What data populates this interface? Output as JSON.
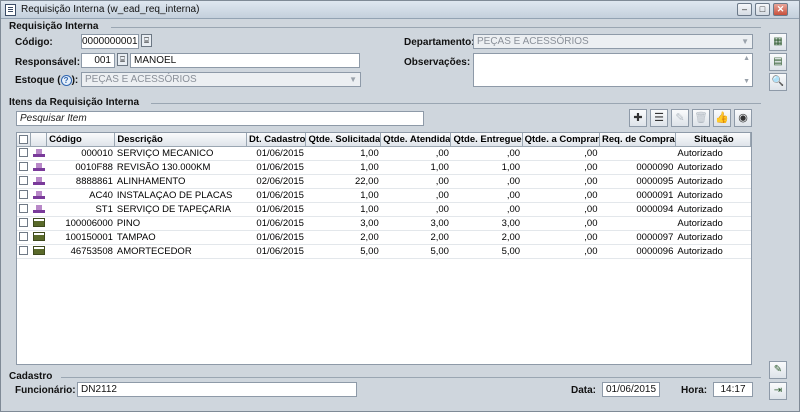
{
  "window": {
    "title": "Requisição Interna (w_ead_req_interna)"
  },
  "header_section": {
    "label": "Requisição Interna",
    "codigo_label": "Código:",
    "codigo_value": "0000000001",
    "responsavel_label": "Responsável:",
    "responsavel_code": "001",
    "responsavel_name": "MANOEL",
    "estoque_label": "Estoque (",
    "estoque_label_end": "):",
    "help_glyph": "?",
    "estoque_value": "PEÇAS E ACESSÓRIOS",
    "departamento_label": "Departamento:",
    "departamento_value": "PEÇAS E ACESSÓRIOS",
    "observacoes_label": "Observações:"
  },
  "items_section": {
    "label": "Itens da Requisição Interna",
    "search_placeholder": "Pesquisar Item",
    "columns": [
      "",
      "",
      "Código",
      "Descrição",
      "Dt. Cadastro",
      "Qtde. Solicitada",
      "Qtde. Atendida",
      "Qtde. Entregue",
      "Qtde. a Comprar",
      "Req. de Compra",
      "Situação"
    ],
    "rows": [
      {
        "type": "service",
        "codigo": "000010",
        "descricao": "SERVIÇO MECANICO",
        "dt": "01/06/2015",
        "solicitada": "1,00",
        "atendida": ",00",
        "entregue": ",00",
        "comprar": ",00",
        "req": "",
        "situacao": "Autorizado"
      },
      {
        "type": "service",
        "codigo": "0010F88",
        "descricao": "REVISÃO 130.000KM",
        "dt": "01/06/2015",
        "solicitada": "1,00",
        "atendida": "1,00",
        "entregue": "1,00",
        "comprar": ",00",
        "req": "0000090",
        "situacao": "Autorizado"
      },
      {
        "type": "service",
        "codigo": "8888861",
        "descricao": "ALINHAMENTO",
        "dt": "02/06/2015",
        "solicitada": "22,00",
        "atendida": ",00",
        "entregue": ",00",
        "comprar": ",00",
        "req": "0000095",
        "situacao": "Autorizado"
      },
      {
        "type": "service",
        "codigo": "AC40",
        "descricao": "INSTALAÇAO DE PLACAS",
        "dt": "01/06/2015",
        "solicitada": "1,00",
        "atendida": ",00",
        "entregue": ",00",
        "comprar": ",00",
        "req": "0000091",
        "situacao": "Autorizado"
      },
      {
        "type": "service",
        "codigo": "ST1",
        "descricao": "SERVIÇO DE TAPEÇARIA",
        "dt": "01/06/2015",
        "solicitada": "1,00",
        "atendida": ",00",
        "entregue": ",00",
        "comprar": ",00",
        "req": "0000094",
        "situacao": "Autorizado"
      },
      {
        "type": "product",
        "codigo": "100006000",
        "descricao": "PINO",
        "dt": "01/06/2015",
        "solicitada": "3,00",
        "atendida": "3,00",
        "entregue": "3,00",
        "comprar": ",00",
        "req": "",
        "situacao": "Autorizado"
      },
      {
        "type": "product",
        "codigo": "100150001",
        "descricao": "TAMPAO",
        "dt": "01/06/2015",
        "solicitada": "2,00",
        "atendida": "2,00",
        "entregue": "2,00",
        "comprar": ",00",
        "req": "0000097",
        "situacao": "Autorizado"
      },
      {
        "type": "product",
        "codigo": "46753508",
        "descricao": "AMORTECEDOR",
        "dt": "01/06/2015",
        "solicitada": "5,00",
        "atendida": "5,00",
        "entregue": "5,00",
        "comprar": ",00",
        "req": "0000096",
        "situacao": "Autorizado"
      }
    ]
  },
  "cadastro_section": {
    "label": "Cadastro",
    "funcionario_label": "Funcionário:",
    "funcionario_value": "DN2112",
    "data_label": "Data:",
    "data_value": "01/06/2015",
    "hora_label": "Hora:",
    "hora_value": "14:17"
  },
  "icons": {
    "minimize": "minimize-icon",
    "maximize": "maximize-icon",
    "close": "close-icon",
    "toolbar": [
      "add-icon",
      "list-icon",
      "edit-icon",
      "delete-icon",
      "approve-icon",
      "camera-icon"
    ],
    "sidebar": [
      "grid-icon",
      "excel-icon",
      "preview-icon",
      "attachment-icon",
      "exit-icon"
    ]
  }
}
